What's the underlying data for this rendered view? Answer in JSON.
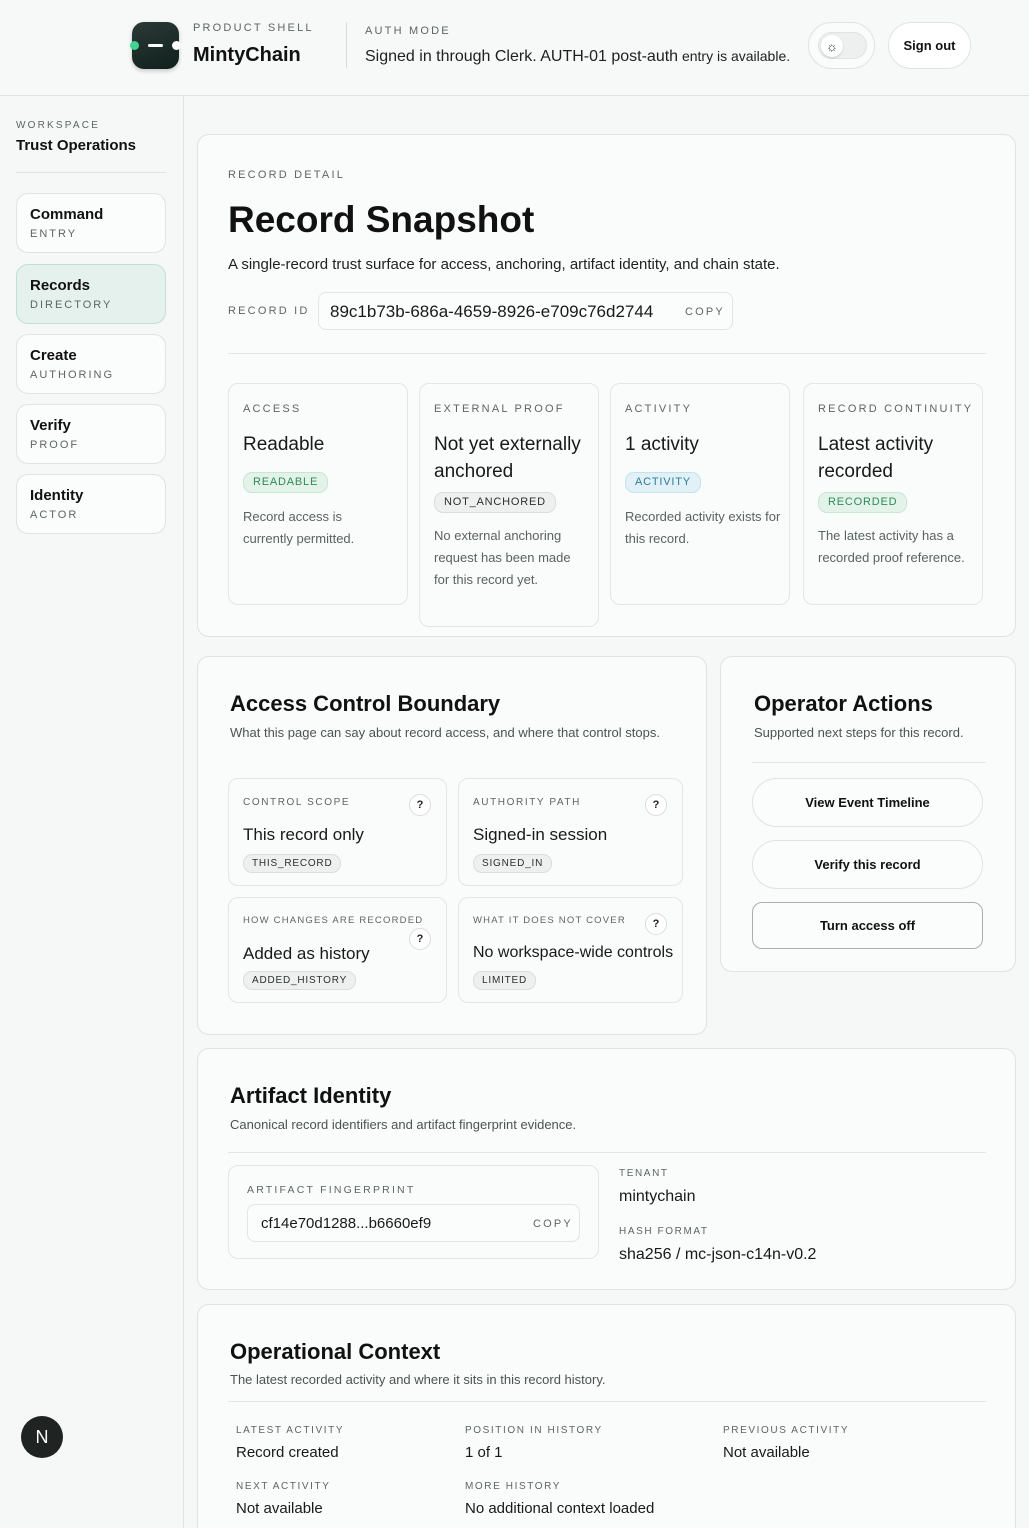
{
  "header": {
    "shell_label": "PRODUCT SHELL",
    "app_name": "MintyChain",
    "auth_label": "AUTH MODE",
    "auth_text_main": "Signed in through Clerk. AUTH-01 post-auth",
    "auth_text_small": " entry is available.",
    "theme_toggle_icon": "sun-icon",
    "sign_out": "Sign out"
  },
  "sidebar": {
    "workspace_label": "WORKSPACE",
    "workspace_name": "Trust Operations",
    "items": [
      {
        "title": "Command",
        "sub": "ENTRY"
      },
      {
        "title": "Records",
        "sub": "DIRECTORY"
      },
      {
        "title": "Create",
        "sub": "AUTHORING"
      },
      {
        "title": "Verify",
        "sub": "PROOF"
      },
      {
        "title": "Identity",
        "sub": "ACTOR"
      }
    ],
    "active_item": "Records",
    "avatar_letter": "N"
  },
  "record": {
    "eyebrow": "RECORD DETAIL",
    "title": "Record Snapshot",
    "subtitle": "A single-record trust surface for access, anchoring, artifact identity, and chain state.",
    "id_label": "RECORD ID",
    "id_value": "89c1b73b-686a-4659-8926-e709c76d2744",
    "copy": "COPY",
    "tiles": [
      {
        "label": "ACCESS",
        "value": "Readable",
        "badge": "READABLE",
        "desc": "Record access is currently permitted."
      },
      {
        "label": "EXTERNAL PROOF",
        "value": "Not yet externally anchored",
        "badge": "NOT_ANCHORED",
        "desc": "No external anchoring request has been made for this record yet."
      },
      {
        "label": "ACTIVITY",
        "value": "1 activity",
        "badge": "ACTIVITY",
        "desc": "Recorded activity exists for this record."
      },
      {
        "label": "RECORD CONTINUITY",
        "value": "Latest activity recorded",
        "badge": "RECORDED",
        "desc": "The latest activity has a recorded proof reference."
      }
    ]
  },
  "access": {
    "title": "Access Control Boundary",
    "subtitle": "What this page can say about record access, and where that control stops.",
    "help": "?",
    "tiles": [
      {
        "label": "CONTROL SCOPE",
        "value": "This record only",
        "badge": "THIS_RECORD"
      },
      {
        "label": "AUTHORITY PATH",
        "value": "Signed-in session",
        "badge": "SIGNED_IN"
      },
      {
        "label": "HOW CHANGES ARE RECORDED",
        "value": "Added as history",
        "badge": "ADDED_HISTORY"
      },
      {
        "label": "WHAT IT DOES NOT COVER",
        "value": "No workspace-wide controls",
        "badge": "LIMITED"
      }
    ]
  },
  "operator": {
    "title": "Operator Actions",
    "subtitle": "Supported next steps for this record.",
    "actions": [
      "View Event Timeline",
      "Verify this record",
      "Turn access off"
    ]
  },
  "artifact": {
    "title": "Artifact Identity",
    "subtitle": "Canonical record identifiers and artifact fingerprint evidence.",
    "fp_label": "ARTIFACT FINGERPRINT",
    "fp_value": "cf14e70d1288...b6660ef9",
    "copy": "COPY",
    "tenant_label": "TENANT",
    "tenant_value": "mintychain",
    "hash_label": "HASH FORMAT",
    "hash_value": "sha256 / mc-json-c14n-v0.2"
  },
  "context": {
    "title": "Operational Context",
    "subtitle": "The latest recorded activity and where it sits in this record history.",
    "items": [
      {
        "label": "LATEST ACTIVITY",
        "value": "Record created"
      },
      {
        "label": "POSITION IN HISTORY",
        "value": "1 of 1"
      },
      {
        "label": "PREVIOUS ACTIVITY",
        "value": "Not available"
      },
      {
        "label": "NEXT ACTIVITY",
        "value": "Not available"
      },
      {
        "label": "MORE HISTORY",
        "value": "No additional context loaded"
      }
    ]
  }
}
